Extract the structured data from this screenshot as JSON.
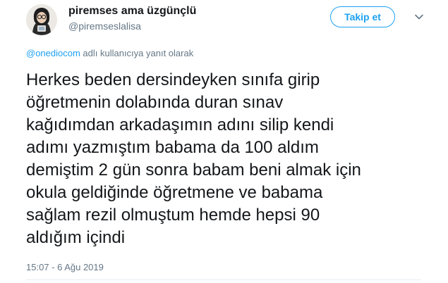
{
  "header": {
    "display_name": "piremses ama üzgünçlü",
    "handle": "@piremseslalisa",
    "follow_label": "Takip et",
    "avatar_icon": "user-avatar-photo",
    "caret_icon": "chevron-down-icon"
  },
  "reply_context": {
    "mention": "@onediocom",
    "suffix": " adlı kullanıcıya yanıt olarak"
  },
  "tweet": {
    "lines": [
      "Herkes beden dersindeyken sınıfa girip",
      "öğretmenin dolabında duran sınav",
      "kağıdımdan arkadaşımın adını silip kendi",
      "adımı yazmıştım babama da 100 aldım",
      "demiştim 2 gün sonra babam beni almak için",
      "okula geldiğinde öğretmene ve babama",
      "sağlam rezil olmuştum hemde hepsi 90",
      "aldığım içindi"
    ],
    "timestamp": "15:07 - 6 Ağu 2019"
  },
  "colors": {
    "accent": "#1da1f2",
    "text": "#14171a",
    "muted": "#657786"
  }
}
